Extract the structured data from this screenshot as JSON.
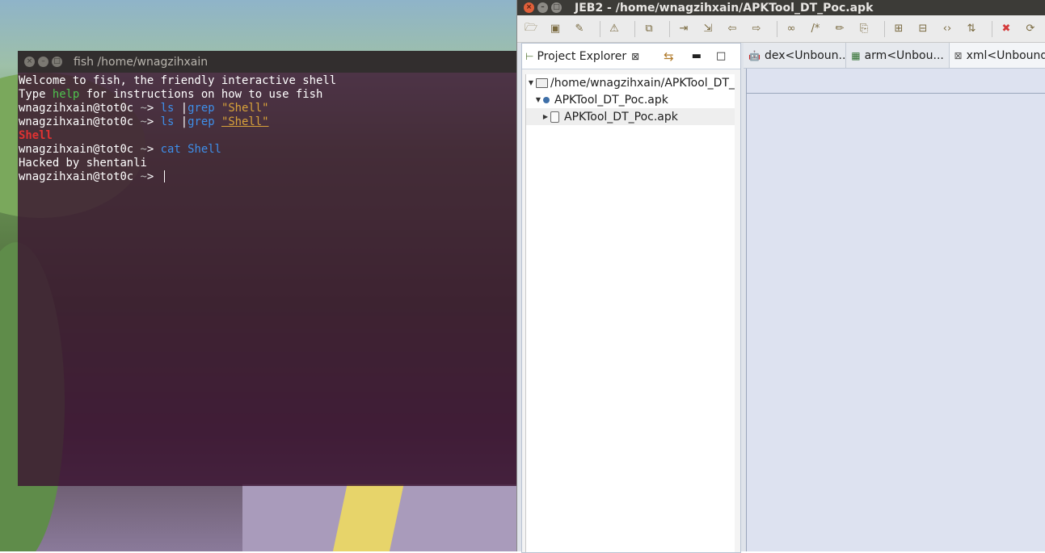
{
  "terminal": {
    "title": "fish  /home/wnagzihxain",
    "lines": [
      {
        "segments": [
          {
            "text": "Welcome to fish, the friendly interactive shell",
            "style": "plain"
          }
        ]
      },
      {
        "segments": [
          {
            "text": "Type ",
            "style": "plain"
          },
          {
            "text": "help",
            "style": "help"
          },
          {
            "text": " for instructions on how to use fish",
            "style": "plain"
          }
        ]
      },
      {
        "segments": [
          {
            "text": "wnagzihxain@tot0c ",
            "style": "plain"
          },
          {
            "text": "~",
            "style": "gray"
          },
          {
            "text": "> ",
            "style": "plain"
          },
          {
            "text": "ls ",
            "style": "cmd"
          },
          {
            "text": "|",
            "style": "plain"
          },
          {
            "text": "grep ",
            "style": "cmd"
          },
          {
            "text": "\"Shell\"",
            "style": "str"
          }
        ]
      },
      {
        "segments": [
          {
            "text": "wnagzihxain@tot0c ",
            "style": "plain"
          },
          {
            "text": "~",
            "style": "gray"
          },
          {
            "text": "> ",
            "style": "plain"
          },
          {
            "text": "ls ",
            "style": "cmd"
          },
          {
            "text": "|",
            "style": "plain"
          },
          {
            "text": "grep ",
            "style": "cmd"
          },
          {
            "text": "\"Shell\"",
            "style": "str-ul"
          }
        ]
      },
      {
        "segments": [
          {
            "text": "Shell",
            "style": "err"
          }
        ]
      },
      {
        "segments": [
          {
            "text": "wnagzihxain@tot0c ",
            "style": "plain"
          },
          {
            "text": "~",
            "style": "gray"
          },
          {
            "text": "> ",
            "style": "plain"
          },
          {
            "text": "cat Shell",
            "style": "cmd"
          }
        ]
      },
      {
        "segments": [
          {
            "text": "Hacked by shentanli",
            "style": "plain"
          }
        ]
      },
      {
        "segments": [
          {
            "text": "wnagzihxain@tot0c ",
            "style": "plain"
          },
          {
            "text": "~",
            "style": "gray"
          },
          {
            "text": "> ",
            "style": "plain"
          }
        ],
        "cursor": true
      }
    ],
    "colors": {
      "help": "#4ec34e",
      "cmd": "#3e8fea",
      "str": "#d9a23a",
      "err": "#e03232"
    }
  },
  "jeb": {
    "title": "JEB2 - /home/wnagzihxain/APKTool_DT_Poc.apk",
    "toolbar_icons": [
      "open-folder-icon",
      "save-icon",
      "wrench-icon",
      "warning-icon",
      "export-icon",
      "step-into-icon",
      "step-over-icon",
      "back-arrow-icon",
      "forward-arrow-icon",
      "link-icon",
      "comment-icon",
      "pencil-icon",
      "bookmark-icon",
      "grid-icon",
      "grid-alt-icon",
      "code-brackets-icon",
      "sort-icon",
      "delete-icon",
      "refresh-icon"
    ],
    "project_explorer": {
      "tab_label": "Project Explorer",
      "tree": [
        {
          "label": "/home/wnagzihxain/APKTool_DT_",
          "level": 0,
          "expanded": true,
          "icon": "folder-icon"
        },
        {
          "label": "APKTool_DT_Poc.apk",
          "level": 1,
          "expanded": true,
          "icon": "dot-icon"
        },
        {
          "label": "APKTool_DT_Poc.apk",
          "level": 2,
          "expanded": false,
          "icon": "apk-icon"
        }
      ]
    },
    "editor_tabs": [
      {
        "label": "dex<Unboun...",
        "icon": "android-icon"
      },
      {
        "label": "arm<Unbou...",
        "icon": "chip-icon"
      },
      {
        "label": "xml<Unbound",
        "icon": "xml-file-icon"
      }
    ]
  }
}
